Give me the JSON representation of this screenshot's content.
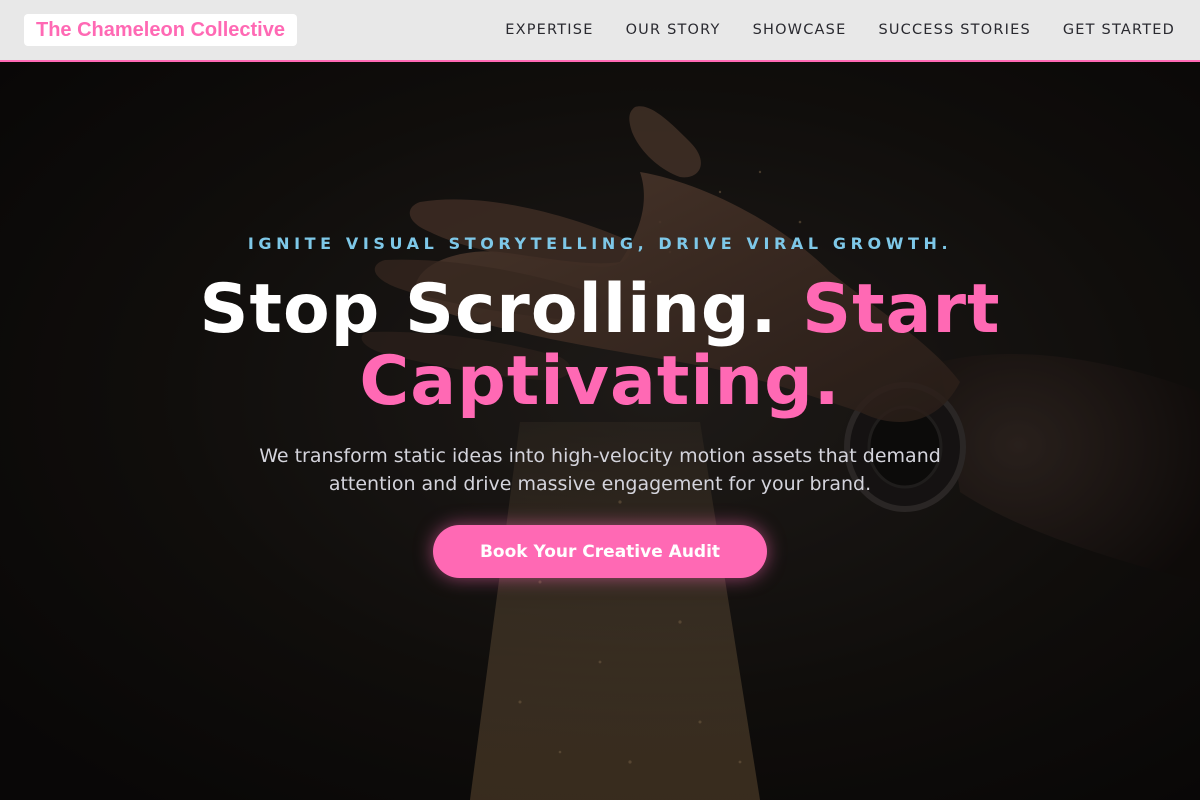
{
  "brand": {
    "name": "The Chameleon Collective",
    "accent_color": "#ff69b4",
    "secondary_color": "#7ec8e8"
  },
  "nav": {
    "items": [
      {
        "label": "EXPERTISE"
      },
      {
        "label": "OUR STORY"
      },
      {
        "label": "SHOWCASE"
      },
      {
        "label": "SUCCESS STORIES"
      },
      {
        "label": "GET STARTED"
      }
    ]
  },
  "hero": {
    "eyebrow": "IGNITE VISUAL STORYTELLING, DRIVE VIRAL GROWTH.",
    "headline_main": "Stop Scrolling.",
    "headline_accent": "Start Captivating.",
    "subtext": "We transform static ideas into high-velocity motion assets that demand attention and drive massive engagement for your brand.",
    "cta_label": "Book Your Creative Audit",
    "background_image": "hand-releasing-sand-photo"
  }
}
